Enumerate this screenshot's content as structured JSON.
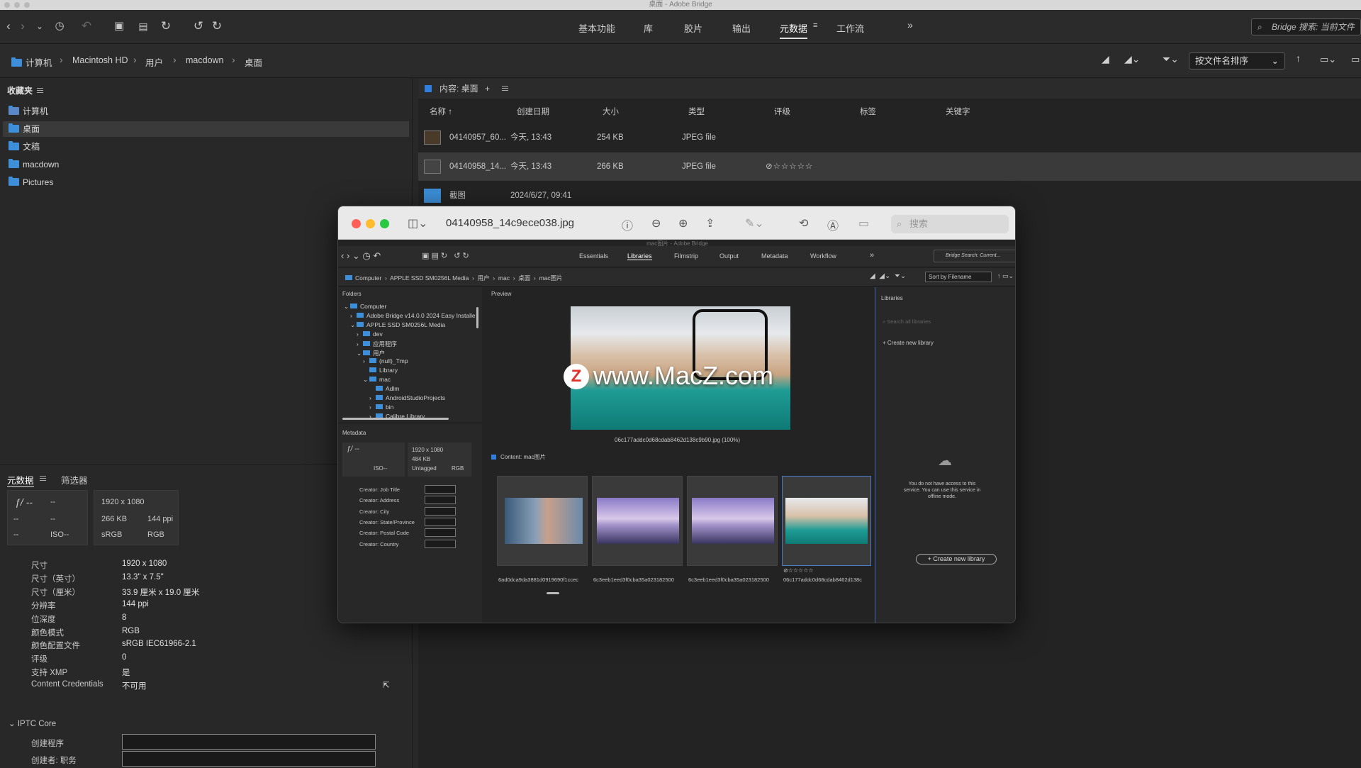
{
  "window": {
    "title": "桌面 - Adobe Bridge"
  },
  "workspaces": [
    {
      "label": "基本功能"
    },
    {
      "label": "库"
    },
    {
      "label": "胶片"
    },
    {
      "label": "输出"
    },
    {
      "label": "元数据",
      "active": true
    },
    {
      "label": "工作流"
    }
  ],
  "search": {
    "placeholder": "Bridge 搜索: 当前文件"
  },
  "path": [
    "计算机",
    "Macintosh HD",
    "用户",
    "macdown",
    "桌面"
  ],
  "sort": {
    "label": "按文件名排序"
  },
  "favorites": {
    "title": "收藏夹",
    "items": [
      {
        "label": "计算机"
      },
      {
        "label": "桌面",
        "selected": true
      },
      {
        "label": "文稿"
      },
      {
        "label": "macdown"
      },
      {
        "label": "Pictures"
      }
    ]
  },
  "content": {
    "title": "内容: 桌面",
    "columns": [
      "名称",
      "创建日期",
      "大小",
      "类型",
      "评级",
      "标签",
      "关键字"
    ],
    "rows": [
      {
        "name": "04140957_60...",
        "date": "今天, 13:43",
        "size": "254 KB",
        "type": "JPEG file",
        "rating": ""
      },
      {
        "name": "04140958_14...",
        "date": "今天, 13:43",
        "size": "266 KB",
        "type": "JPEG file",
        "rating": "⊘☆☆☆☆☆"
      },
      {
        "name": "截图",
        "date": "2024/6/27, 09:41",
        "size": "",
        "type": "",
        "rating": ""
      }
    ]
  },
  "metadata": {
    "tabs": [
      "元数据",
      "筛选器"
    ],
    "summary": {
      "fstop": "ƒ/ --",
      "dash1": "--",
      "dash2": "--",
      "dash3": "--",
      "dash4": "--",
      "iso": "ISO--",
      "dims": "1920 x 1080",
      "size": "266 KB",
      "ppi": "144 ppi",
      "space1": "sRGB",
      "mode": "RGB"
    },
    "fields": [
      {
        "label": "尺寸",
        "value": "1920 x 1080"
      },
      {
        "label": "尺寸（英寸）",
        "value": "13.3\" x 7.5\""
      },
      {
        "label": "尺寸（厘米）",
        "value": "33.9 厘米 x 19.0 厘米"
      },
      {
        "label": "分辨率",
        "value": "144 ppi"
      },
      {
        "label": "位深度",
        "value": "8"
      },
      {
        "label": "颜色模式",
        "value": "RGB"
      },
      {
        "label": "颜色配置文件",
        "value": "sRGB IEC61966-2.1"
      },
      {
        "label": "评级",
        "value": "0"
      },
      {
        "label": "支持 XMP",
        "value": "是"
      },
      {
        "label": "Content Credentials",
        "value": "不可用"
      }
    ],
    "section": "IPTC Core",
    "iptc": [
      {
        "label": "创建程序"
      },
      {
        "label": "创建者: 职务"
      }
    ]
  },
  "preview": {
    "filename": "04140958_14c9ece038.jpg",
    "search_placeholder": "搜索",
    "inner": {
      "title": "mac图片 - Adobe Bridge",
      "workspaces": [
        "Essentials",
        "Libraries",
        "Filmstrip",
        "Output",
        "Metadata",
        "Workflow"
      ],
      "search": "Bridge Search: Current...",
      "path": [
        "Computer",
        "APPLE SSD SM0256L Media",
        "用户",
        "mac",
        "桌面",
        "mac图片"
      ],
      "sort": "Sort by Filename",
      "folders_title": "Folders",
      "tree": [
        "Computer",
        "Adobe Bridge v14.0.0 2024 Easy Installe",
        "APPLE SSD SM0256L Media",
        "dev",
        "应用程序",
        "用户",
        "(null)_Tmp",
        "Library",
        "mac",
        "Adlm",
        "AndroidStudioProjects",
        "bin",
        "Calibre Library"
      ],
      "preview_title": "Preview",
      "watermark": "www.MacZ.com",
      "preview_caption": "06c177addc0d68cdab8462d138c9b90.jpg (100%)",
      "libraries_title": "Libraries",
      "lib_search": "Search all libraries",
      "create_lib": "Create new library",
      "offline_msg": "You do not have access to this service. You can use this service in offline mode.",
      "create_lib_btn": "+ Create new library",
      "metadata_title": "Metadata",
      "meta_summary": {
        "fstop": "ƒ/ --",
        "dims": "1920 x 1080",
        "size": "484 KB",
        "tag": "Untagged",
        "mode": "RGB",
        "iso": "ISO--"
      },
      "meta_fields": [
        "Creator: Job Title",
        "Creator: Address",
        "Creator: City",
        "Creator: State/Province",
        "Creator: Postal Code",
        "Creator: Country"
      ],
      "content_title": "Content: mac图片",
      "thumbs": [
        "6ad0dca9da3881d0919690f1ccec",
        "6c3eeb1eed3f0cba35a023182500",
        "6c3eeb1eed3f0cba35a023182500",
        "06c177addc0d68cdab8462d138c"
      ],
      "thumb_rating": "⊘☆☆☆☆☆"
    }
  }
}
